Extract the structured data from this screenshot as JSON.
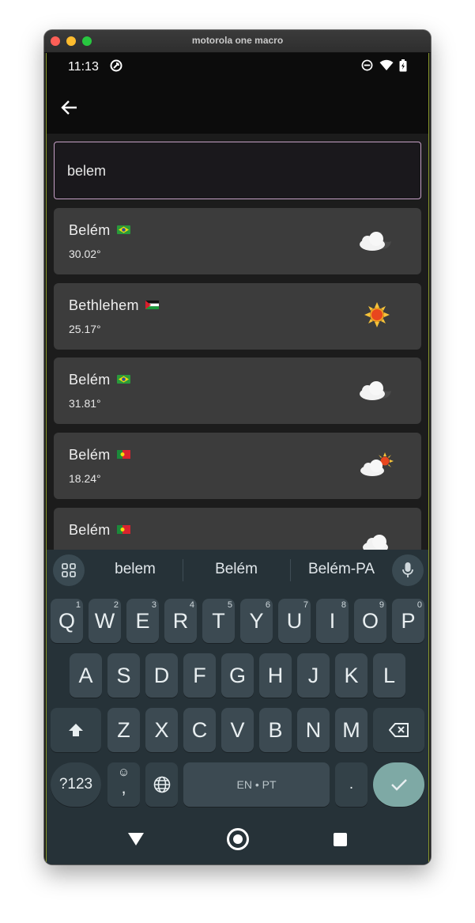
{
  "window": {
    "title": "motorola one macro"
  },
  "status": {
    "time": "11:13"
  },
  "search": {
    "value": "belem",
    "placeholder": ""
  },
  "results": [
    {
      "city": "Belém",
      "flag": "brazil-flag",
      "temp": "30.02°",
      "weather": "partly-cloudy-night-icon"
    },
    {
      "city": "Bethlehem",
      "flag": "palestine-flag",
      "temp": "25.17°",
      "weather": "sunny-icon"
    },
    {
      "city": "Belém",
      "flag": "brazil-flag",
      "temp": "31.81°",
      "weather": "partly-cloudy-night-icon"
    },
    {
      "city": "Belém",
      "flag": "portugal-flag",
      "temp": "18.24°",
      "weather": "partly-sunny-icon"
    },
    {
      "city": "Belém",
      "flag": "portugal-flag",
      "temp": "",
      "weather": "cloudy-icon"
    }
  ],
  "keyboard": {
    "suggestions": [
      "belem",
      "Belém",
      "Belém-PA"
    ],
    "row1": [
      "Q",
      "W",
      "E",
      "R",
      "T",
      "Y",
      "U",
      "I",
      "O",
      "P"
    ],
    "row1_hints": [
      "1",
      "2",
      "3",
      "4",
      "5",
      "6",
      "7",
      "8",
      "9",
      "0"
    ],
    "row2": [
      "A",
      "S",
      "D",
      "F",
      "G",
      "H",
      "J",
      "K",
      "L"
    ],
    "row3": [
      "Z",
      "X",
      "C",
      "V",
      "B",
      "N",
      "M"
    ],
    "symbols_label": "?123",
    "emoji_comma_top": "☺",
    "emoji_comma_bottom": ",",
    "space_label": "EN • PT",
    "period_label": "."
  }
}
